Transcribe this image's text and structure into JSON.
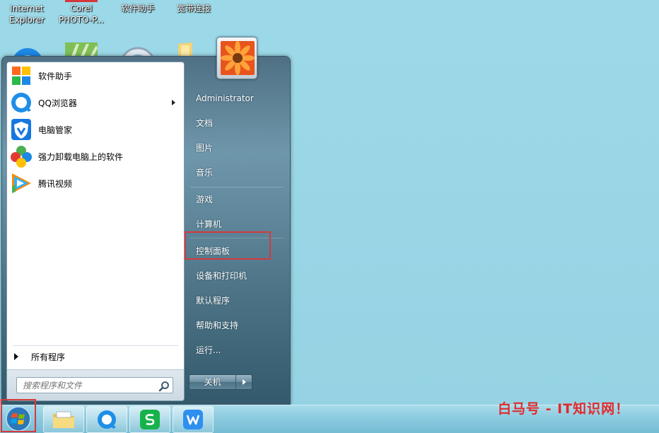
{
  "desktop": {
    "icons": [
      {
        "label_line1": "Internet",
        "label_line2": "Explorer"
      },
      {
        "label_line1": "Corel",
        "label_line2": "PHOTO-P..."
      },
      {
        "label_line1": "软件助手",
        "label_line2": ""
      },
      {
        "label_line1": "宽带连接",
        "label_line2": ""
      }
    ]
  },
  "start_menu": {
    "pinned_programs": [
      {
        "label": "软件助手",
        "icon": "app-grid-icon"
      },
      {
        "label": "QQ浏览器",
        "icon": "qq-browser-icon"
      },
      {
        "label": "电脑管家",
        "icon": "pc-manager-shield-icon"
      },
      {
        "label": "强力卸载电脑上的软件",
        "icon": "uninstaller-icon"
      },
      {
        "label": "腾讯视频",
        "icon": "tencent-video-icon"
      }
    ],
    "all_programs_label": "所有程序",
    "search_placeholder": "搜索程序和文件",
    "right_items": [
      {
        "label": "Administrator"
      },
      {
        "label": "文档"
      },
      {
        "label": "图片"
      },
      {
        "label": "音乐"
      },
      {
        "label": "游戏"
      },
      {
        "label": "计算机"
      },
      {
        "label": "控制面板",
        "highlighted": true
      },
      {
        "label": "设备和打印机"
      },
      {
        "label": "默认程序"
      },
      {
        "label": "帮助和支持"
      },
      {
        "label": "运行..."
      }
    ],
    "shutdown_label": "关机"
  },
  "taskbar": {
    "pinned": [
      "file-explorer-icon",
      "qq-browser-icon",
      "wps-spreadsheet-icon",
      "wps-writer-icon"
    ]
  },
  "watermark": "白马号 - IT知识网！",
  "colors": {
    "highlight": "#d6393d",
    "desktop": "#98d6e6",
    "watermark": "#e02a2a"
  }
}
